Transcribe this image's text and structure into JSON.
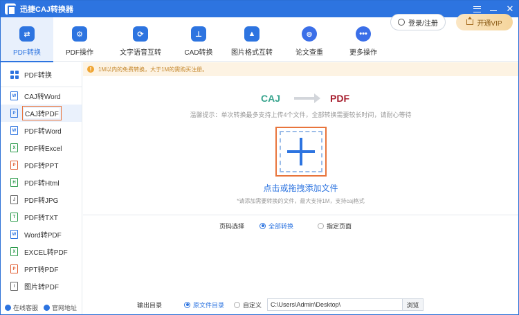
{
  "app": {
    "title": "迅捷CAJ转换器"
  },
  "toolbar": {
    "tools": [
      {
        "label": "PDF转换",
        "icon": "swap-arrows-icon",
        "glyph": "⇄"
      },
      {
        "label": "PDF操作",
        "icon": "gear-icon",
        "glyph": "⚙"
      },
      {
        "label": "文字语音互转",
        "icon": "speech-text-icon",
        "glyph": "⟳"
      },
      {
        "label": "CAD转换",
        "icon": "cad-ruler-icon",
        "glyph": "⊥"
      },
      {
        "label": "图片格式互转",
        "icon": "image-icon",
        "glyph": "▲"
      },
      {
        "label": "论文查重",
        "icon": "search-document-icon",
        "glyph": "⊜"
      },
      {
        "label": "更多操作",
        "icon": "more-dots-icon",
        "glyph": "•••"
      }
    ],
    "login_label": "登录/注册",
    "vip_label": "开通VIP"
  },
  "sidebar": {
    "header": "PDF转换",
    "items": [
      {
        "label": "CAJ转Word",
        "icon": "word-file-icon",
        "color": "#2d74e0",
        "glyph": "W"
      },
      {
        "label": "CAJ转PDF",
        "icon": "pdf-file-icon",
        "color": "#2d74e0",
        "glyph": "P"
      },
      {
        "label": "PDF转Word",
        "icon": "word-file-icon",
        "color": "#2d74e0",
        "glyph": "W"
      },
      {
        "label": "PDF转Excel",
        "icon": "excel-file-icon",
        "color": "#2a9a4a",
        "glyph": "X"
      },
      {
        "label": "PDF转PPT",
        "icon": "ppt-file-icon",
        "color": "#e05a2d",
        "glyph": "P"
      },
      {
        "label": "PDF转Html",
        "icon": "html-file-icon",
        "color": "#2a9a4a",
        "glyph": "H"
      },
      {
        "label": "PDF转JPG",
        "icon": "jpg-file-icon",
        "color": "#666666",
        "glyph": "J"
      },
      {
        "label": "PDF转TXT",
        "icon": "txt-file-icon",
        "color": "#2a9a4a",
        "glyph": "T"
      },
      {
        "label": "Word转PDF",
        "icon": "pdf-file-icon",
        "color": "#2d74e0",
        "glyph": "W"
      },
      {
        "label": "EXCEL转PDF",
        "icon": "pdf-file-icon",
        "color": "#2a9a4a",
        "glyph": "X"
      },
      {
        "label": "PPT转PDF",
        "icon": "pdf-file-icon",
        "color": "#e05a2d",
        "glyph": "P"
      },
      {
        "label": "图片转PDF",
        "icon": "image-file-icon",
        "color": "#666666",
        "glyph": "I"
      }
    ],
    "active_index": 1,
    "footer": {
      "service": "在线客服",
      "website": "官网地址"
    }
  },
  "notice": "1M以内的免费转换，大于1M的需购买注册。",
  "flow": {
    "from": "CAJ",
    "to": "PDF"
  },
  "hint": "温馨提示：单次转换最多支持上传4个文件，全部转换需要较长时间，请耐心等待",
  "drop": {
    "label": "点击或拖拽添加文件",
    "sub": "*请添加需要转换的文件，最大支持1M，支持caj格式"
  },
  "page_select": {
    "label": "页码选择",
    "options": [
      "全部转换",
      "指定页面"
    ],
    "selected": 0
  },
  "output": {
    "label": "输出目录",
    "options": [
      "原文件目录",
      "自定义"
    ],
    "selected": 0,
    "path": "C:\\Users\\Admin\\Desktop\\",
    "browse": "浏览"
  },
  "colors": {
    "primary": "#2d74e0",
    "accent_outline": "#e8743b",
    "notice_text": "#c5872c",
    "caj": "#3aa58f",
    "pdf": "#a61d2d"
  }
}
